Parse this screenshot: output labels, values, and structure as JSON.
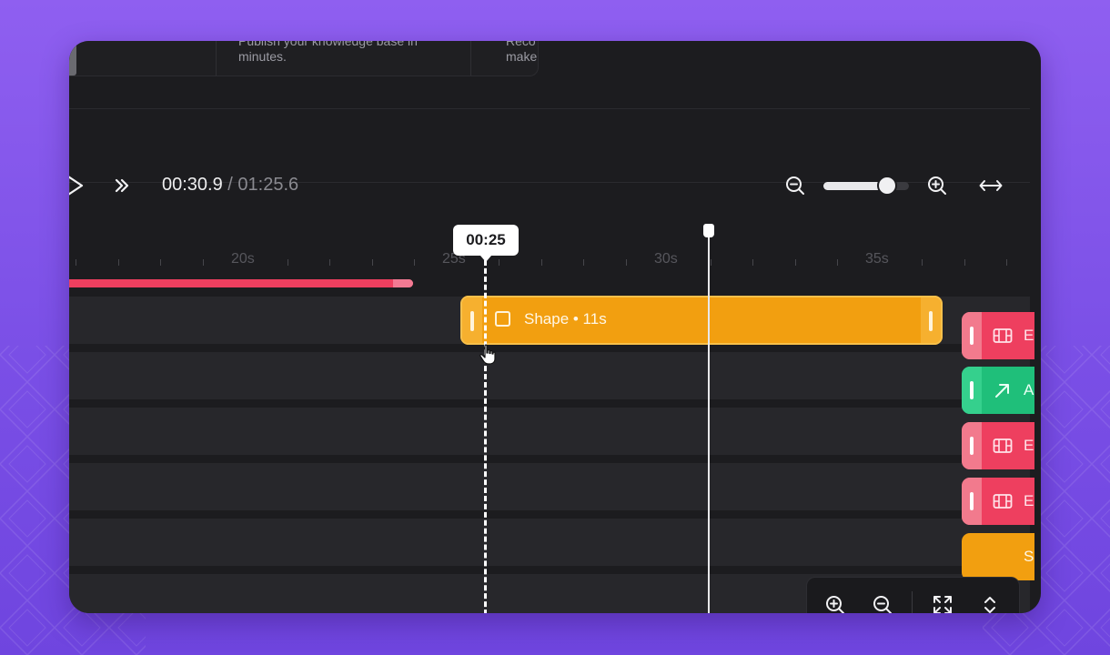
{
  "top_cards": {
    "card1_line1": "Publish your knowledge base in",
    "card1_line2": "minutes.",
    "card2_line1": "Reco",
    "card2_line2": "make"
  },
  "player": {
    "current_time": "00:30.9",
    "separator": " / ",
    "total_time": "01:25.6",
    "zoom_level": 0.74
  },
  "ruler": {
    "labels": [
      "20s",
      "25s",
      "30s",
      "35s"
    ]
  },
  "hover_tooltip": "00:25",
  "clips": {
    "shape_label": "Shape • 11s",
    "right_clip_labels": [
      "E",
      "A",
      "E",
      "E",
      "S"
    ]
  },
  "colors": {
    "shape_clip": "#f29f10",
    "pink_clip": "#ee3f5f",
    "green_clip": "#1fbf7a",
    "magenta_clip": "#c93fd6",
    "background": "#7a4fe6"
  },
  "icons": {
    "play": "play-icon",
    "fast_forward": "fast-forward-icon",
    "zoom_out": "zoom-out-icon",
    "zoom_in": "zoom-in-icon",
    "fit_width": "horizontal-arrows-icon",
    "expand": "expand-icon",
    "collapse_vertical": "chevron-up-down-icon"
  }
}
